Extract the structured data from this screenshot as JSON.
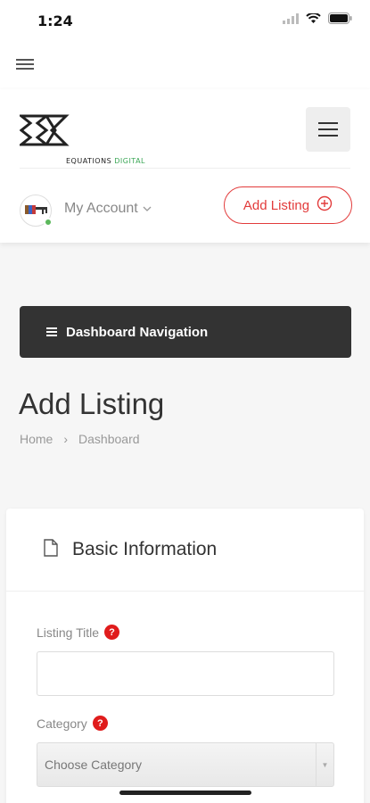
{
  "status": {
    "time": "1:24"
  },
  "header": {
    "logo_text_main": "EQUATIONS",
    "logo_text_accent": "DIGITAL",
    "account_label": "My Account",
    "add_listing_label": "Add Listing"
  },
  "dashboard_nav": {
    "label": "Dashboard Navigation"
  },
  "page": {
    "title": "Add Listing",
    "breadcrumb": [
      "Home",
      "Dashboard"
    ]
  },
  "form": {
    "section_title": "Basic Information",
    "listing_title_label": "Listing Title",
    "listing_title_value": "",
    "category_label": "Category",
    "category_selected": "Choose Category",
    "help_glyph": "?"
  },
  "colors": {
    "accent": "#e23b3b",
    "online": "#5cb85c",
    "nav_bg": "#333333"
  },
  "icons": [
    "wifi-icon",
    "battery-icon",
    "hamburger-icon",
    "chevron-down-icon",
    "plus-circle-icon",
    "document-icon",
    "help-icon"
  ]
}
